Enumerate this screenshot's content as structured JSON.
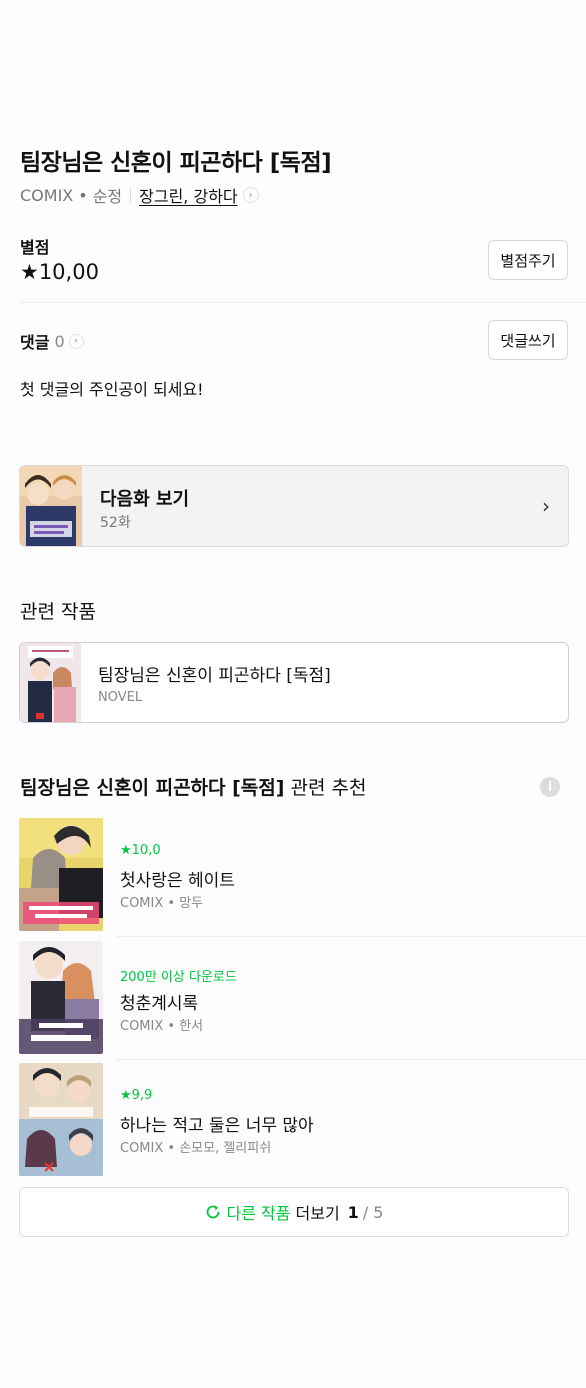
{
  "header": {
    "title": "팀장님은 신혼이 피곤하다 [독점]",
    "type": "COMIX",
    "dot": "•",
    "genre": "순정",
    "authors": "장그린, 강하다",
    "author_chevron": "›"
  },
  "rating": {
    "label": "별점",
    "value": "★10,00",
    "button_label": "별점주기"
  },
  "comments": {
    "label": "댓글",
    "count": "0",
    "chevron": "›",
    "button_label": "댓글쓰기",
    "empty_message": "첫 댓글의 주인공이 되세요!"
  },
  "next_episode": {
    "title": "다음화 보기",
    "episode": "52화",
    "arrow": "›"
  },
  "related": {
    "section_title": "관련 작품",
    "items": [
      {
        "title": "팀장님은 신혼이 피곤하다 [독점]",
        "type": "NOVEL"
      }
    ]
  },
  "recommend": {
    "title_bold": "팀장님은 신혼이 피곤하다 [독점]",
    "title_rest": " 관련 추천",
    "info_icon": "i",
    "items": [
      {
        "badge": "★10,0",
        "name": "첫사랑은 헤이트",
        "sub": "COMIX • 망두"
      },
      {
        "badge": "200만 이상 다운로드",
        "name": "청춘계시록",
        "sub": "COMIX • 한서"
      },
      {
        "badge": "★9,9",
        "name": "하나는 적고 둘은 너무 많아",
        "sub": "COMIX • 손모모, 젤리피쉬"
      }
    ]
  },
  "more": {
    "label_green": "다른 작품",
    "label_dark": "더보기",
    "current": "1",
    "total": "/ 5"
  },
  "colors": {
    "accent": "#00c73c",
    "text": "#111111",
    "muted": "#777777",
    "border": "#dcdcdc"
  }
}
